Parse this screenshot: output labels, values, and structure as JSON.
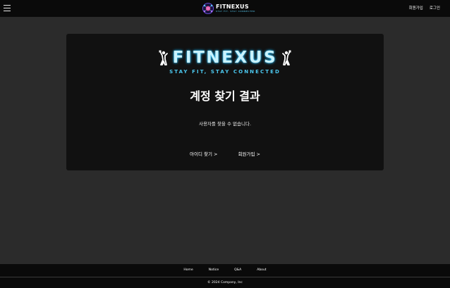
{
  "header": {
    "logo": {
      "brand": "FITNEXUS",
      "tagline": "STAY FIT, STAY CONNECTED"
    },
    "links": {
      "signup": "회원가입",
      "login": "로그인"
    },
    "icons": {
      "menu": "hamburger-menu-icon"
    }
  },
  "card": {
    "logo": {
      "brand": "FITNEXUS",
      "tagline": "STAY FIT, STAY CONNECTED"
    },
    "title": "계정 찾기 결과",
    "message": "사용자를 찾을 수 없습니다.",
    "actions": {
      "find_id": "아이디 찾기 >",
      "signup": "회원가입 >"
    }
  },
  "footer": {
    "nav": [
      "Home",
      "Notice",
      "Q&A",
      "About"
    ],
    "copyright": "© 2024 Company, Inc"
  },
  "colors": {
    "page_bg": "#2b2b2b",
    "header_bg": "#0a0a0a",
    "card_bg": "#111111",
    "accent": "#4cc9f0"
  }
}
